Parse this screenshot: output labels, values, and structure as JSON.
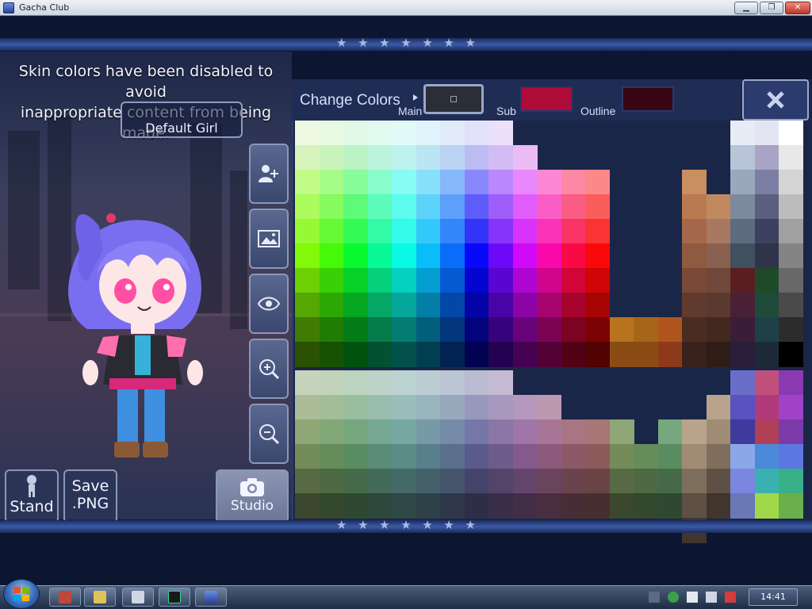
{
  "window": {
    "title": "Gacha Club",
    "minimize": "▁",
    "maximize": "❐",
    "close": "✕"
  },
  "notice": {
    "line1": "Skin colors have been disabled to avoid",
    "line2": "inappropriate content from being made."
  },
  "character": {
    "name": "Default Girl"
  },
  "side_buttons": [
    {
      "name": "add-character-button",
      "icon": "add-person-icon"
    },
    {
      "name": "background-button",
      "icon": "image-icon"
    },
    {
      "name": "visibility-button",
      "icon": "eye-icon"
    },
    {
      "name": "zoom-in-button",
      "icon": "zoom-in-icon"
    },
    {
      "name": "zoom-out-button",
      "icon": "zoom-out-icon"
    }
  ],
  "bottom_buttons": {
    "stand_label": "Stand",
    "save_line1": "Save",
    "save_line2": ".PNG",
    "studio_label": "Studio"
  },
  "color_panel": {
    "title": "Change Colors",
    "main_label": "Main",
    "sub_label": "Sub",
    "outline_label": "Outline",
    "main_color": "#2a2e36",
    "sub_color": "#b00c3a",
    "outline_color": "#3a0614",
    "close_icon": "close-x-icon"
  },
  "taskbar": {
    "time": "14:41",
    "items": [
      "archive-app",
      "file-manager",
      "tool-app",
      "terminal-app",
      "gacha-club-app"
    ]
  }
}
